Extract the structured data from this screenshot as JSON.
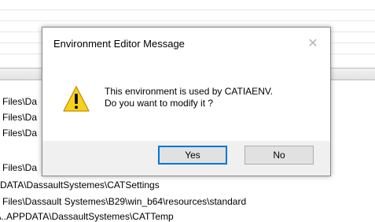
{
  "background": {
    "lines": [
      {
        "text": "Files\\Da"
      },
      {
        "text": "Files\\Da"
      },
      {
        "text": "Files\\Da"
      },
      {
        "text": "Files\\Da"
      },
      {
        "text": "DATA\\DassaultSystemes\\CATSettings"
      },
      {
        "text": "Files\\Dassault Systemes\\B29\\win_b64\\resources\\standard"
      },
      {
        "text": "\\..APPDATA\\DassaultSystemes\\CATTemp"
      }
    ]
  },
  "dialog": {
    "title": "Environment Editor Message",
    "close_icon": "close-icon",
    "message_line1": "This environment is used by CATIAENV.",
    "message_line2": "Do you want to modify it ?",
    "icon": "warning-icon",
    "yes_label": "Yes",
    "no_label": "No"
  },
  "colors": {
    "accent": "#0078d7",
    "warning_fill": "#f7d21b",
    "footer_bg": "#f0f0f0"
  }
}
